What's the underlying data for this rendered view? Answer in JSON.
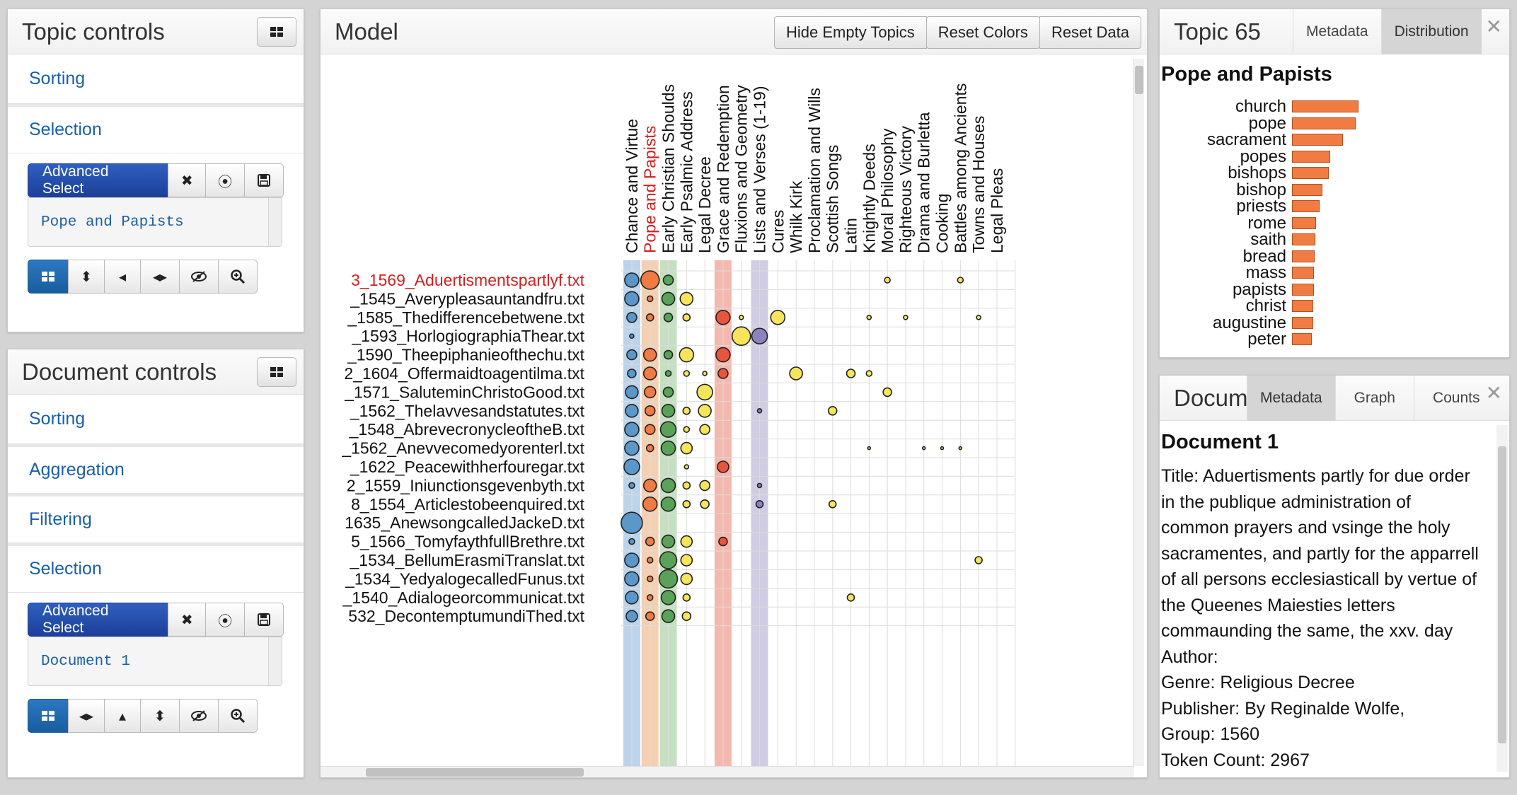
{
  "topic_controls": {
    "title": "Topic controls",
    "sections": [
      "Sorting",
      "Selection"
    ],
    "advanced_select_label": "Advanced Select",
    "selected_value": "Pope and Papists"
  },
  "document_controls": {
    "title": "Document controls",
    "sections": [
      "Sorting",
      "Aggregation",
      "Filtering",
      "Selection"
    ],
    "advanced_select_label": "Advanced Select",
    "selected_value": "Document 1"
  },
  "model": {
    "title": "Model",
    "buttons": [
      "Hide Empty Topics",
      "Reset Colors",
      "Reset Data"
    ],
    "selected_topic_color": "#d21f1f",
    "topics": [
      "Chance and Virtue",
      "Pope and Papists",
      "Early Christian Shoulds",
      "Early Psalmic Address",
      "Legal Decree",
      "Grace and Redemption",
      "Fluxions and Geometry",
      "Lists and Verses (1-19)",
      "Cures",
      "Whilk Kirk",
      "Proclamation and Wills",
      "Scottish Songs",
      "Latin",
      "Knightly Deeds",
      "Moral Philosophy",
      "Righteous Victory",
      "Drama and Burletta",
      "Cooking",
      "Battles among Ancients",
      "Towns and Houses",
      "Legal Pleas"
    ],
    "selected_topic_index": 1,
    "selected_document_index": 0,
    "documents": [
      "3_1569_Aduertismentspartlyf.txt",
      "_1545_Averypleasauntandfru.txt",
      "_1585_Thedifferencebetwene.txt",
      "_1593_HorlogiographiaThear.txt",
      "_1590_Theepiphanieofthechu.txt",
      "2_1604_Offermaidtoagentilma.txt",
      "_1571_SaluteminChristoGood.txt",
      "_1562_Thelavvesandstatutes.txt",
      "_1548_AbrevecronycleoftheB.txt",
      "_1562_Anevvecomedyorenterl.txt",
      "_1622_Peacewithherfouregar.txt",
      "2_1559_Iniunctionsgevenbyth.txt",
      "8_1554_Articlestobeenquired.txt",
      "1635_AnewsongcalledJackeD.txt",
      "5_1566_TomyfaythfullBrethre.txt",
      "_1534_BellumErasmiTranslat.txt",
      "_1534_YedyalogecalledFunus.txt",
      "_1540_Adialogeorcommunicat.txt",
      "532_DecontemptumundiThed.txt"
    ],
    "column_bands": [
      {
        "col": 0,
        "color": "#bcd4ea"
      },
      {
        "col": 1,
        "color": "#f4d0b3"
      },
      {
        "col": 2,
        "color": "#c4e0c0"
      },
      {
        "col": 5,
        "color": "#f4b9ae"
      },
      {
        "col": 7,
        "color": "#d0cce2"
      }
    ],
    "circles": [
      [
        [
          0,
          10,
          "#5b97c9"
        ],
        [
          1,
          13,
          "#f07b43"
        ],
        [
          2,
          7,
          "#5aa25a"
        ],
        [
          14,
          4,
          "#f6e55b"
        ],
        [
          18,
          4,
          "#f6e55b"
        ]
      ],
      [
        [
          0,
          10,
          "#5b97c9"
        ],
        [
          1,
          4,
          "#f07b43"
        ],
        [
          2,
          9,
          "#5aa25a"
        ],
        [
          3,
          9,
          "#f6e55b"
        ]
      ],
      [
        [
          0,
          7,
          "#5b97c9"
        ],
        [
          1,
          5,
          "#f07b43"
        ],
        [
          2,
          6,
          "#5aa25a"
        ],
        [
          3,
          5,
          "#f6e55b"
        ],
        [
          5,
          10,
          "#e8553f"
        ],
        [
          6,
          3,
          "#f6e55b"
        ],
        [
          8,
          10,
          "#f6e55b"
        ],
        [
          13,
          3,
          "#f6e55b"
        ],
        [
          15,
          3,
          "#f6e55b"
        ],
        [
          19,
          3,
          "#f6e55b"
        ]
      ],
      [
        [
          0,
          3,
          "#5b97c9"
        ],
        [
          6,
          13,
          "#f6e55b"
        ],
        [
          7,
          11,
          "#8c82c0"
        ]
      ],
      [
        [
          0,
          7,
          "#5b97c9"
        ],
        [
          1,
          9,
          "#f07b43"
        ],
        [
          2,
          6,
          "#5aa25a"
        ],
        [
          3,
          10,
          "#f6e55b"
        ],
        [
          5,
          10,
          "#e8553f"
        ]
      ],
      [
        [
          0,
          6,
          "#5b97c9"
        ],
        [
          1,
          9,
          "#f07b43"
        ],
        [
          2,
          4,
          "#5aa25a"
        ],
        [
          3,
          4,
          "#f6e55b"
        ],
        [
          4,
          3,
          "#f6e55b"
        ],
        [
          5,
          7,
          "#e8553f"
        ],
        [
          9,
          9,
          "#f6e55b"
        ],
        [
          12,
          6,
          "#f6e55b"
        ],
        [
          13,
          4,
          "#f6e55b"
        ]
      ],
      [
        [
          0,
          9,
          "#5b97c9"
        ],
        [
          1,
          8,
          "#f07b43"
        ],
        [
          2,
          7,
          "#5aa25a"
        ],
        [
          4,
          11,
          "#f6e55b"
        ],
        [
          14,
          6,
          "#f6e55b"
        ]
      ],
      [
        [
          0,
          9,
          "#5b97c9"
        ],
        [
          1,
          7,
          "#f07b43"
        ],
        [
          2,
          9,
          "#5aa25a"
        ],
        [
          3,
          5,
          "#f6e55b"
        ],
        [
          4,
          9,
          "#f6e55b"
        ],
        [
          7,
          3,
          "#8c82c0"
        ],
        [
          11,
          6,
          "#f6e55b"
        ]
      ],
      [
        [
          0,
          10,
          "#5b97c9"
        ],
        [
          1,
          7,
          "#f07b43"
        ],
        [
          2,
          11,
          "#5aa25a"
        ],
        [
          3,
          4,
          "#f6e55b"
        ],
        [
          4,
          7,
          "#f6e55b"
        ]
      ],
      [
        [
          0,
          10,
          "#5b97c9"
        ],
        [
          1,
          5,
          "#f07b43"
        ],
        [
          2,
          10,
          "#5aa25a"
        ],
        [
          3,
          8,
          "#f6e55b"
        ],
        [
          13,
          2,
          "#f6e55b"
        ],
        [
          16,
          2,
          "#f6e55b"
        ],
        [
          17,
          2,
          "#f6e55b"
        ],
        [
          18,
          2,
          "#f6e55b"
        ]
      ],
      [
        [
          0,
          11,
          "#5b97c9"
        ],
        [
          3,
          3,
          "#f6e55b"
        ],
        [
          5,
          8,
          "#e8553f"
        ]
      ],
      [
        [
          0,
          4,
          "#5b97c9"
        ],
        [
          1,
          9,
          "#f07b43"
        ],
        [
          2,
          10,
          "#5aa25a"
        ],
        [
          3,
          5,
          "#f6e55b"
        ],
        [
          4,
          7,
          "#f6e55b"
        ],
        [
          7,
          3,
          "#8c82c0"
        ]
      ],
      [
        [
          1,
          10,
          "#f07b43"
        ],
        [
          2,
          10,
          "#5aa25a"
        ],
        [
          3,
          5,
          "#f6e55b"
        ],
        [
          4,
          6,
          "#f6e55b"
        ],
        [
          7,
          5,
          "#8c82c0"
        ],
        [
          11,
          5,
          "#f6e55b"
        ]
      ],
      [
        [
          0,
          15,
          "#5b97c9"
        ]
      ],
      [
        [
          0,
          4,
          "#5b97c9"
        ],
        [
          1,
          6,
          "#f07b43"
        ],
        [
          2,
          9,
          "#5aa25a"
        ],
        [
          3,
          8,
          "#f6e55b"
        ],
        [
          5,
          6,
          "#e8553f"
        ]
      ],
      [
        [
          0,
          10,
          "#5b97c9"
        ],
        [
          1,
          4,
          "#f07b43"
        ],
        [
          2,
          12,
          "#5aa25a"
        ],
        [
          3,
          8,
          "#f6e55b"
        ],
        [
          19,
          5,
          "#f6e55b"
        ]
      ],
      [
        [
          0,
          10,
          "#5b97c9"
        ],
        [
          1,
          4,
          "#f07b43"
        ],
        [
          2,
          13,
          "#5aa25a"
        ],
        [
          3,
          8,
          "#f6e55b"
        ]
      ],
      [
        [
          0,
          9,
          "#5b97c9"
        ],
        [
          1,
          4,
          "#f07b43"
        ],
        [
          2,
          10,
          "#5aa25a"
        ],
        [
          3,
          5,
          "#f6e55b"
        ],
        [
          12,
          5,
          "#f6e55b"
        ]
      ],
      [
        [
          0,
          8,
          "#5b97c9"
        ],
        [
          1,
          6,
          "#f07b43"
        ],
        [
          2,
          9,
          "#5aa25a"
        ],
        [
          3,
          6,
          "#f6e55b"
        ]
      ]
    ]
  },
  "topic_panel": {
    "title": "Topic 65",
    "tabs": [
      "Metadata",
      "Distribution"
    ],
    "active_tab": "Distribution",
    "heading": "Pope and Papists",
    "bar_color": "#f07b43",
    "words": [
      {
        "word": "church",
        "weight": 1.0
      },
      {
        "word": "pope",
        "weight": 0.96
      },
      {
        "word": "sacrament",
        "weight": 0.77
      },
      {
        "word": "popes",
        "weight": 0.57
      },
      {
        "word": "bishops",
        "weight": 0.55
      },
      {
        "word": "bishop",
        "weight": 0.46
      },
      {
        "word": "priests",
        "weight": 0.41
      },
      {
        "word": "rome",
        "weight": 0.36
      },
      {
        "word": "saith",
        "weight": 0.35
      },
      {
        "word": "bread",
        "weight": 0.34
      },
      {
        "word": "mass",
        "weight": 0.33
      },
      {
        "word": "papists",
        "weight": 0.33
      },
      {
        "word": "christ",
        "weight": 0.32
      },
      {
        "word": "augustine",
        "weight": 0.32
      },
      {
        "word": "peter",
        "weight": 0.3
      }
    ]
  },
  "document_panel": {
    "title": "Document",
    "tabs": [
      "Metadata",
      "Graph",
      "Counts"
    ],
    "active_tab": "Metadata",
    "heading": "Document 1",
    "lines": [
      "Title: Aduertisments partly for due order",
      "in the publique administration of",
      "common prayers and vsinge the holy",
      "sacramentes, and partly for the apparrell",
      "of all persons ecclesiasticall by vertue of",
      "the Queenes Maiesties letters",
      "commaunding the same, the xxv. day",
      "Author:",
      "Genre: Religious Decree",
      "Publisher: By Reginalde Wolfe,",
      "Group: 1560",
      "Token Count: 2967"
    ]
  }
}
